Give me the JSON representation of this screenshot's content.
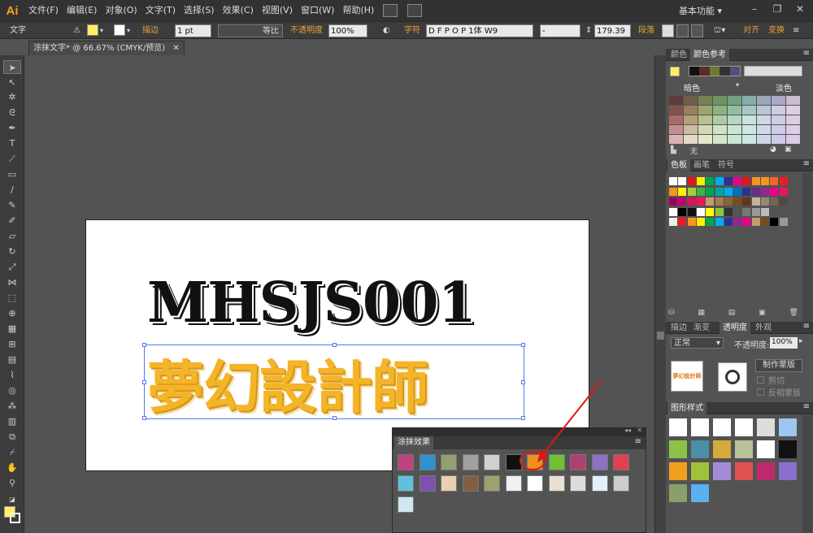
{
  "app": {
    "logo": "Ai",
    "workspace": "基本功能"
  },
  "menu": [
    "文件(F)",
    "编辑(E)",
    "对象(O)",
    "文字(T)",
    "选择(S)",
    "效果(C)",
    "视图(V)",
    "窗口(W)",
    "帮助(H)"
  ],
  "control": {
    "tool_label": "文字",
    "stroke_label": "描边",
    "stroke_weight": "1 pt",
    "stroke_profile": "等比",
    "opacity_label": "不透明度",
    "opacity_value": "100%",
    "char_label": "字符",
    "font_name": "D F P O P 1体 W9",
    "font_style": "-",
    "font_size": "179.39",
    "para_label": "段落",
    "align_label": "对齐",
    "transform_label": "变换"
  },
  "document": {
    "tab_title": "涂抹文字* @ 66.67% (CMYK/预览)"
  },
  "artwork": {
    "english": "MHSJS001",
    "chinese": "夢幻設計師"
  },
  "panels": {
    "color_tabs": [
      "颜色",
      "颜色参考"
    ],
    "color_ref_dark": "暗色",
    "color_ref_light": "淡色",
    "color_ref_none": "无",
    "swatch_tabs": [
      "色板",
      "画笔",
      "符号"
    ],
    "transp_tabs": [
      "描边",
      "渐变",
      "透明度",
      "外观"
    ],
    "blend_mode": "正常",
    "opacity_label": "不透明度:",
    "opacity_value": "100%",
    "make_mask": "制作蒙版",
    "clip": "剪切",
    "invert_mask": "反相蒙版",
    "graphic_styles_title": "图形样式",
    "scribble_title": "涂抹效果"
  },
  "colors": {
    "accent": "#f7a21b",
    "selection": "#4c7bf2",
    "fill": "#ffee66"
  }
}
